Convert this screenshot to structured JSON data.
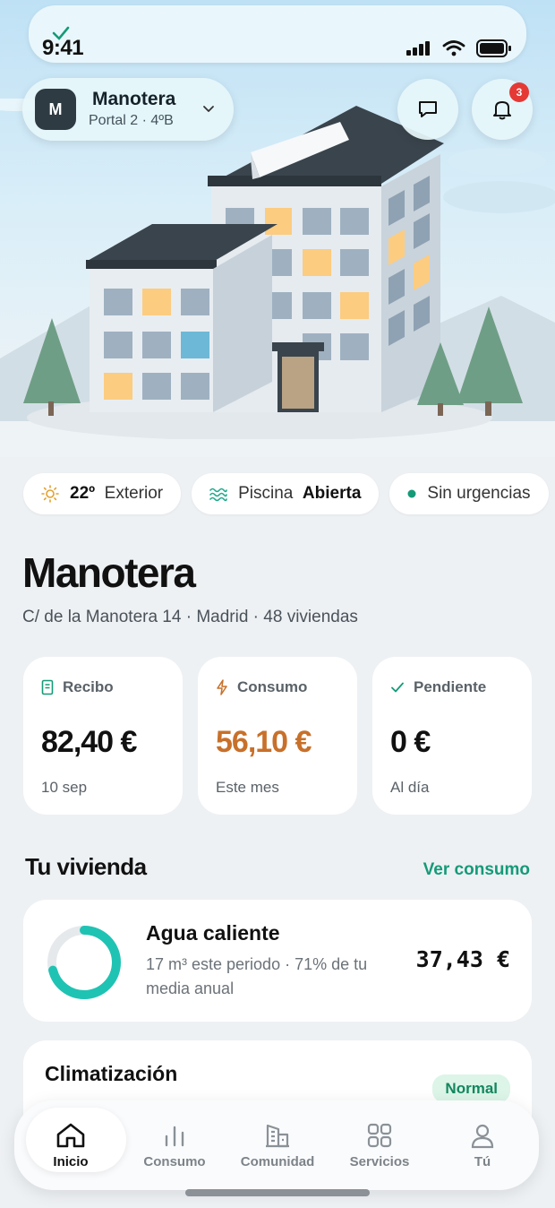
{
  "status_bar": {
    "time": "9:41"
  },
  "profile": {
    "initial": "M",
    "name": "Manotera",
    "subtitle": "Portal 2 · 4ºB"
  },
  "notifications": {
    "badge_count": "3"
  },
  "chips": [
    {
      "icon": "sun-icon",
      "value": "22º",
      "label": "Exterior"
    },
    {
      "icon": "pool-waves-icon",
      "label": "Piscina",
      "value": "Abierta"
    },
    {
      "icon": "green-dot-icon",
      "label": "Sin urgencias"
    }
  ],
  "building": {
    "name": "Manotera",
    "address": "C/ de la Manotera 14 · Madrid · 48 viviendas"
  },
  "stats": [
    {
      "icon": "receipt-icon",
      "label": "Recibo",
      "value": "82,40 €",
      "sub": "10 sep",
      "color": "#111111"
    },
    {
      "icon": "bolt-icon",
      "label": "Consumo",
      "value": "56,10 €",
      "sub": "Este mes",
      "color": "#c8702a"
    },
    {
      "icon": "check-icon",
      "label": "Pendiente",
      "value": "0 €",
      "sub": "Al día",
      "color": "#111111"
    }
  ],
  "section": {
    "title": "Tu vivienda",
    "link": "Ver consumo"
  },
  "cards": [
    {
      "title": "Agua caliente",
      "desc_line1": "17 m³ este periodo · 71% de tu",
      "desc_line2": "media anual",
      "amount": "37,43 €",
      "progress": 0.71
    },
    {
      "title": "Climatización",
      "badge": "Normal"
    }
  ],
  "tabs": [
    {
      "label": "Inicio",
      "icon": "home-icon",
      "active": true
    },
    {
      "label": "Consumo",
      "icon": "bar-chart-icon",
      "active": false
    },
    {
      "label": "Comunidad",
      "icon": "buildings-icon",
      "active": false
    },
    {
      "label": "Servicios",
      "icon": "grid-icon",
      "active": false
    },
    {
      "label": "Tú",
      "icon": "user-icon",
      "active": false
    }
  ],
  "colors": {
    "accent": "#159a78",
    "ring": "#1fc3b3",
    "badge": "#e53935",
    "consumo": "#c8702a"
  }
}
